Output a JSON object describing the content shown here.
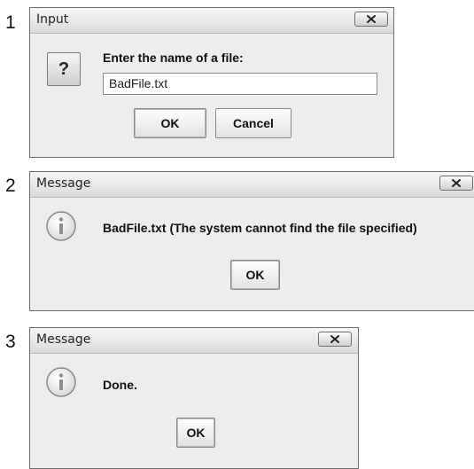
{
  "steps": [
    "1",
    "2",
    "3"
  ],
  "dialog1": {
    "title": "Input",
    "prompt": "Enter the name of a file:",
    "input_value": "BadFile.txt",
    "ok_label": "OK",
    "cancel_label": "Cancel",
    "icon": "question-icon"
  },
  "dialog2": {
    "title": "Message",
    "message": "BadFile.txt (The system cannot find the file specified)",
    "ok_label": "OK",
    "icon": "info-icon"
  },
  "dialog3": {
    "title": "Message",
    "message": "Done.",
    "ok_label": "OK",
    "icon": "info-icon"
  }
}
